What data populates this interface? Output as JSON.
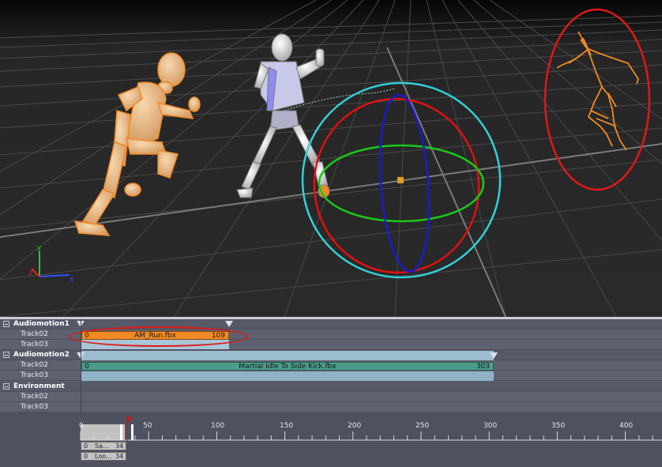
{
  "viewport": {
    "axis_labels": {
      "x": "x",
      "y": "y",
      "z": "z"
    }
  },
  "tracks": {
    "groups": [
      {
        "name": "Audiomotion1",
        "tracks": [
          "Track02",
          "Track03"
        ]
      },
      {
        "name": "Audiomotion2",
        "tracks": [
          "Track02",
          "Track03"
        ]
      },
      {
        "name": "Environment",
        "tracks": [
          "Track02",
          "Track03"
        ]
      }
    ],
    "clips": {
      "run": {
        "start": "0",
        "name": "AM_Run.fbx",
        "end": "109"
      },
      "kick": {
        "start": "0",
        "name": "Martial Idle To Side Kick.fbx",
        "end": "303"
      }
    }
  },
  "ruler": {
    "ticks": [
      "0",
      "50",
      "100",
      "150",
      "200",
      "250",
      "300",
      "350",
      "400"
    ],
    "current_frame": "34",
    "cues": [
      {
        "start": "0",
        "name": "Sa...",
        "end": "34"
      },
      {
        "start": "0",
        "name": "Loo...",
        "end": "34"
      }
    ]
  },
  "colors": {
    "selection_orange": "#f08a24",
    "clip_teal": "#4d9c8a",
    "highlight_red": "#e01818",
    "gizmo_cyan": "#33d0d8",
    "gizmo_red": "#e01010",
    "gizmo_green": "#18c818",
    "gizmo_blue": "#1a1ad0"
  }
}
